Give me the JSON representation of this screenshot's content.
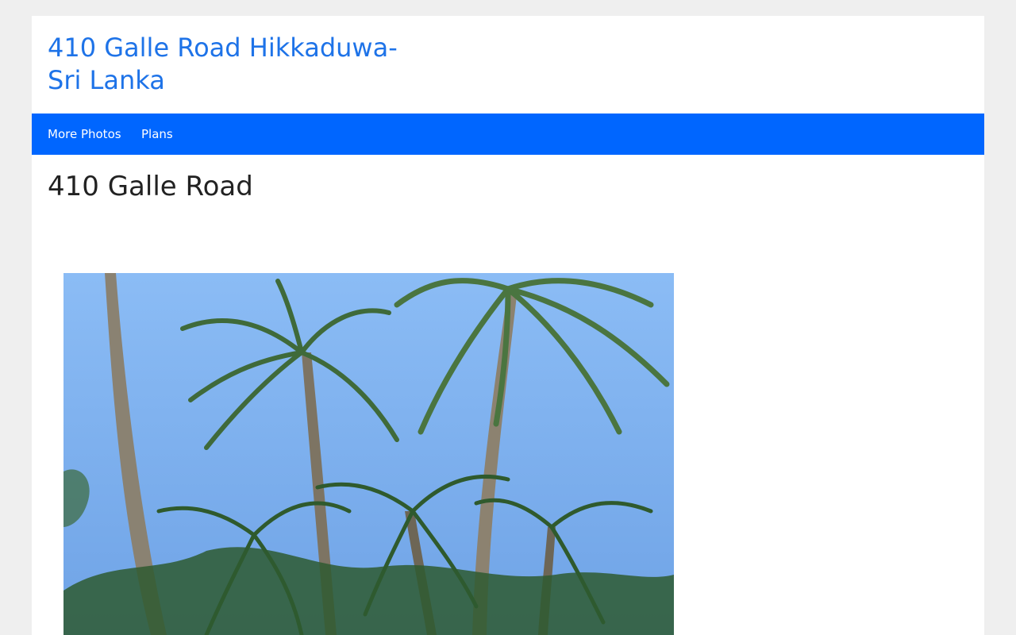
{
  "site": {
    "title": "410 Galle Road Hikkaduwa-Sri Lanka",
    "title_color": "#1e73e8"
  },
  "nav": {
    "background": "#0066ff",
    "items": [
      {
        "label": "More Photos"
      },
      {
        "label": "Plans"
      }
    ]
  },
  "page": {
    "title": "410 Galle Road"
  },
  "photo": {
    "subject": "palm-trees-photo",
    "sky_color": "#7fb0ef"
  }
}
